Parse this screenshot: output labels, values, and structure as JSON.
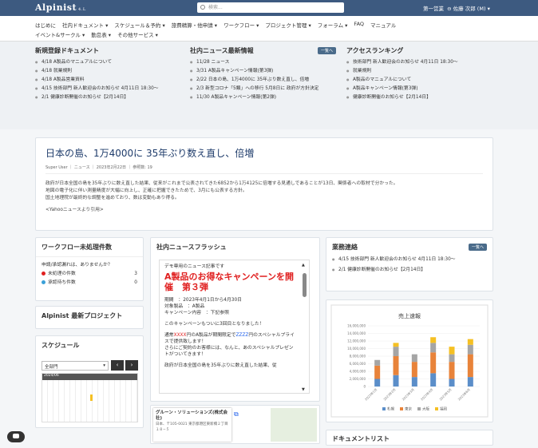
{
  "header": {
    "logo": "Alpinist",
    "logo_sub": "4.L",
    "search_placeholder": "検索...",
    "division": "第一営業",
    "user": "佐藤 次郎 (M)"
  },
  "nav": {
    "row1": [
      "はじめに",
      "社内ドキュメント",
      "スケジュール＆予約",
      "旅費精算・他申請",
      "ワークフロー",
      "プロジェクト管理",
      "フォーラム",
      "FAQ",
      "マニュアル"
    ],
    "row2": [
      "イベント&サークル",
      "勤怠表",
      "その他サービス"
    ]
  },
  "new_docs": {
    "title": "新規登録ドキュメント",
    "items": [
      "4/18 A製品のマニュアルについて",
      "4/18 就業規則",
      "4/18 A製品営業資料",
      "4/15 技術部門 新人歓迎会のお知らせ 4月11日 18:30〜",
      "2/1 健康診断開催のお知らせ【2月14日】"
    ]
  },
  "company_news": {
    "title": "社内ニュース最新情報",
    "more": "一覧へ",
    "items": [
      "11/28 ニュース",
      "3/31 A製品キャンペーン情報(第3弾)",
      "2/22 日本の島、1万4000に 35年ぶり数え直し、倍増",
      "2/3 新型コロナ「5類」への移行 5月8日に 政府が方針決定",
      "11/30 A製品キャンペーン情報(第2弾)"
    ]
  },
  "ranking": {
    "title": "アクセスランキング",
    "items": [
      "技術部門 新人歓迎会のお知らせ 4月11日 18:30〜",
      "就業規則",
      "A製品のマニュアルについて",
      "A製品キャンペーン情報(第3弾)",
      "健康診断開催のお知らせ【2月14日】"
    ]
  },
  "article": {
    "title": "日本の島、1万4000に 35年ぶり数え直し、倍増",
    "meta": "Super User ｜ ニュース ｜ 2023年2月22日 ｜ 参照数: 19",
    "p1": "政府が日本全国の島を35年ぶりに数え直した結果、従来がこれまで公表されてきた6852から1万4125に倍増する見通しであることが13日、関係者への取材で分かった。",
    "p2": "地図の電子化に伴い測量精度が大幅に向上し、正確に把握できたためで、3月にも公表する方針。",
    "p3": "国土地理院が最終的な調整を進めており、数は変動もあり得る。",
    "p4": "<Yahooニュースより引用>"
  },
  "workflow": {
    "title": "ワークフロー未処理件数",
    "msg": "申請/承認漏れは、ありませんか？",
    "pending_label": "未処理の件数",
    "pending_value": "3",
    "approval_label": "承認待ち件数",
    "approval_value": "0"
  },
  "project": {
    "title": "Alpinist 最新プロジェクト"
  },
  "schedule": {
    "title": "スケジュール",
    "select": "全部門",
    "date": "2024/06"
  },
  "flash": {
    "title": "社内ニュースフラッシュ",
    "l1": "デモ専用のニュース記事です",
    "big": "A製品のお得なキャンペーンを開催　第３弾",
    "l2": "期間　：2023年4月1日から4月30日",
    "l3": "対象製品　：A製品",
    "l4": "キャンペーン内容　：下記参照",
    "l5": "このキャンペーンもついに3回目となりました！",
    "l6a": "通常",
    "l6b": "XXXX",
    "l6c": "円のA製品が期間限定で",
    "l6d": "ZZZZ",
    "l6e": "円のスペシャルプライスで提供致します！",
    "l7": "さらにご契約のお客様には、なんと、あのスペシャルプレゼントがついてきます！",
    "l8": "政府が日本全国の島を35年ぶりに数え直した結果、従"
  },
  "map": {
    "company": "グルーン・ソリューションズ(株式会社)",
    "addr": "日本、〒105-0021 東京都港区東新橋２丁目１８−５"
  },
  "gyomu": {
    "title": "業務連絡",
    "more": "一覧へ",
    "items": [
      "4/15 技術部門 新人歓迎会のお知らせ 4月11日 18:30〜",
      "2/1 健康診断開催のお知らせ【2月14日】"
    ]
  },
  "doclist": {
    "title": "ドキュメントリスト"
  },
  "chart_data": {
    "type": "bar",
    "title": "売上速報",
    "categories": [
      "2023年1月",
      "2023年2月",
      "2023年3月",
      "2023年4月",
      "2023年5月",
      "2023年6月"
    ],
    "ylim": [
      0,
      16000000
    ],
    "yticks": [
      "0",
      "2,000,000",
      "4,000,000",
      "6,000,000",
      "8,000,000",
      "10,000,000",
      "12,000,000",
      "14,000,000",
      "16,000,000"
    ],
    "series": [
      {
        "name": "札幌",
        "color": "#5b8ec9",
        "values": [
          2000000,
          3000000,
          2500000,
          3500000,
          2000000,
          2500000
        ]
      },
      {
        "name": "東京",
        "color": "#e8833a",
        "values": [
          3500000,
          5000000,
          4000000,
          5500000,
          4500000,
          6000000
        ]
      },
      {
        "name": "大阪",
        "color": "#a5a5a5",
        "values": [
          1500000,
          2500000,
          2000000,
          2500000,
          2000000,
          2500000
        ]
      },
      {
        "name": "福岡",
        "color": "#f5c023",
        "values": [
          0,
          1000000,
          0,
          1500000,
          2000000,
          1500000
        ]
      }
    ]
  }
}
